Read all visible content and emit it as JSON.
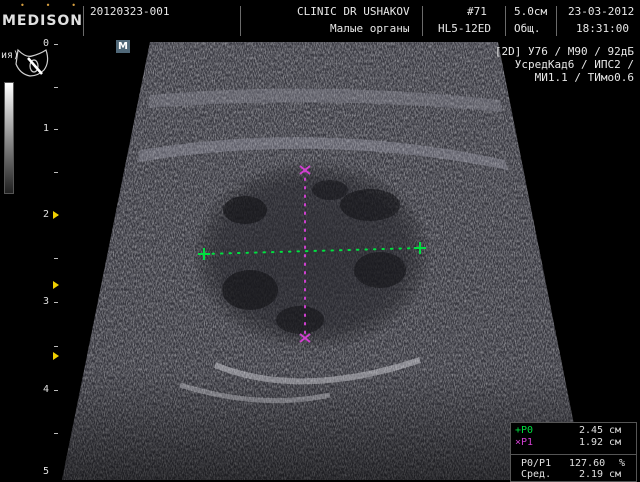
{
  "header": {
    "logo": "MEDISON",
    "patient_id": "20120323-001",
    "clinic": "CLINIC DR USHAKOV",
    "exam_type": "Малые органы",
    "frame_number": "#71",
    "probe": "HL5-12ED",
    "depth": "5.0см",
    "preset": "Общ.",
    "date": "23-03-2012",
    "time": "18:31:00"
  },
  "image": {
    "mode_badge": "M",
    "left_label": "ия)",
    "depth_labels": [
      "0",
      "1",
      "2",
      "3",
      "4",
      "5"
    ]
  },
  "parameters": {
    "line1": "[2D] У76 / М90 / 92дБ",
    "line2": "УсредКад6 / ИПС2 /",
    "line3": "МИ1.1 / ТИмо0.6"
  },
  "measurements": {
    "p0_symbol": "+P0",
    "p0_value": "2.45",
    "p0_unit": "см",
    "p1_symbol": "×P1",
    "p1_value": "1.92",
    "p1_unit": "см",
    "ratio_label": "P0/P1",
    "ratio_value": "127.60",
    "ratio_unit": "%",
    "mean_label": "Сред.",
    "mean_value": "2.19",
    "mean_unit": "см"
  },
  "colors": {
    "p0_caliper": "#00e040",
    "p1_caliper": "#d040d0",
    "focus_marker": "#f0d000"
  }
}
